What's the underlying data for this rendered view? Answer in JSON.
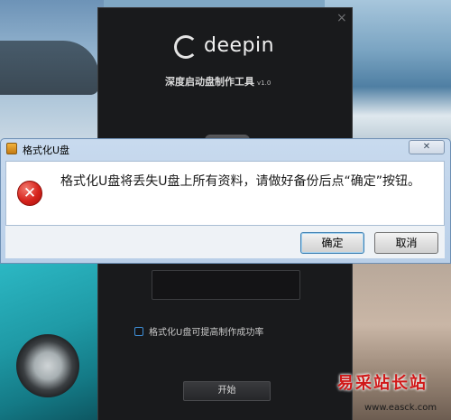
{
  "deepin_app": {
    "logo_text": "deepin",
    "title": "深度启动盘制作工具",
    "version": "v1.0",
    "close_glyph": "×",
    "format_option_label": "格式化U盘可提高制作成功率",
    "start_button_label": "开始"
  },
  "dialog": {
    "title": "格式化U盘",
    "close_glyph": "✕",
    "error_glyph": "✕",
    "message": "格式化U盘将丢失U盘上所有资料，请做好备份后点“确定”按钮。",
    "ok_label": "确定",
    "cancel_label": "取消",
    "icons": {
      "title_icon": "usb-drive-icon",
      "message_icon": "error-icon"
    }
  },
  "watermark": {
    "text": "易采站长站",
    "url": "www.easck.com"
  },
  "colors": {
    "deepin_bg": "#191a1c",
    "dialog_frame": "#c8daee",
    "error_red": "#d6231c",
    "checkbox_blue": "#3f8fd6",
    "watermark_red": "#d01818"
  }
}
